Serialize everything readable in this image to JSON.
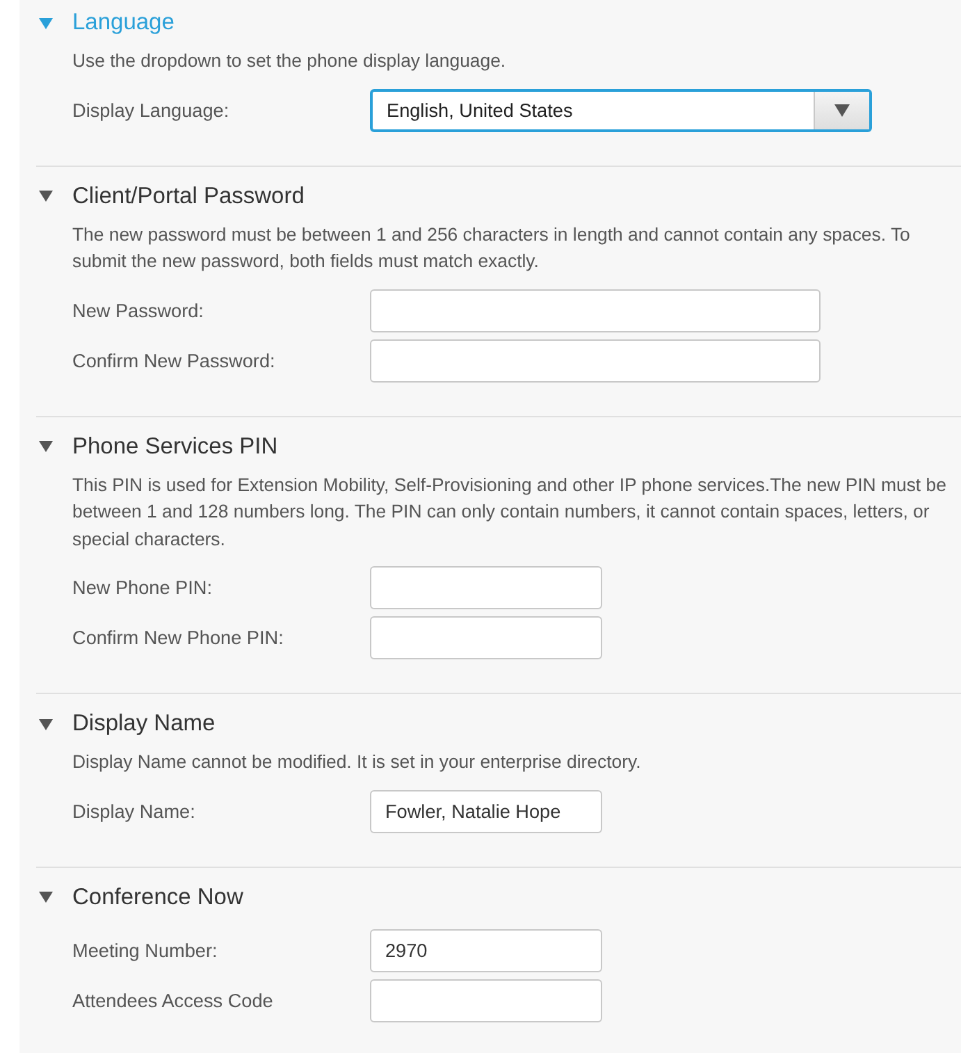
{
  "sections": [
    {
      "title": "Language",
      "active": true,
      "expanded": true,
      "description": "Use the dropdown to set the phone display language.",
      "fields": [
        {
          "label": "Display Language:",
          "kind": "select",
          "value": "English, United States",
          "focused": true
        }
      ]
    },
    {
      "title": "Client/Portal Password",
      "active": false,
      "expanded": true,
      "description": "The new password must be between 1 and 256 characters in length and cannot contain any spaces. To submit the new password, both fields must match exactly.",
      "fields": [
        {
          "label": "New Password:",
          "kind": "wide",
          "focused": false
        },
        {
          "label": "Confirm New Password:",
          "kind": "wide",
          "focused": false
        }
      ]
    },
    {
      "title": "Phone Services PIN",
      "active": false,
      "expanded": true,
      "description": "This PIN is used for Extension Mobility, Self-Provisioning and other IP phone services.The new PIN must be between 1 and 128 numbers long. The PIN can only contain numbers, it cannot contain spaces, letters, or special characters.",
      "fields": [
        {
          "label": "New Phone PIN:",
          "kind": "narrow",
          "focused": false
        },
        {
          "label": "Confirm New Phone PIN:",
          "kind": "narrow",
          "focused": false
        }
      ]
    },
    {
      "title": "Display Name",
      "active": false,
      "expanded": true,
      "description": "Display Name cannot be modified. It is set in your enterprise directory.",
      "fields": [
        {
          "label": "Display Name:",
          "kind": "narrow",
          "value": "Fowler, Natalie Hope",
          "focused": false
        }
      ]
    },
    {
      "title": "Conference Now",
      "active": false,
      "expanded": true,
      "fields": [
        {
          "label": "Meeting Number:",
          "kind": "narrow",
          "value": "2970",
          "focused": false
        },
        {
          "label": "Attendees Access Code",
          "kind": "narrow",
          "focused": false
        }
      ]
    }
  ]
}
